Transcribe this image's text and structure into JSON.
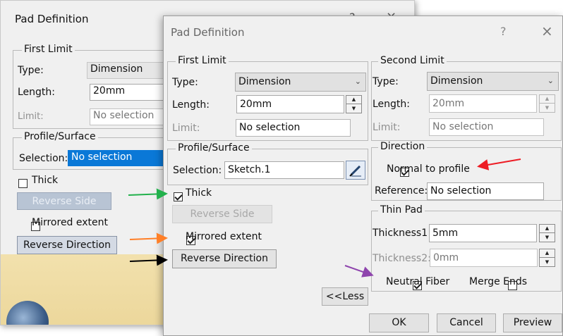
{
  "back_dialog": {
    "title": "Pad Definition",
    "help": "?",
    "close": "×",
    "first_limit": {
      "group_label": "First Limit",
      "type_label": "Type:",
      "type_value": "Dimension",
      "length_label": "Length:",
      "length_value": "20mm",
      "limit_label": "Limit:",
      "limit_value": "No selection"
    },
    "profile_surface": {
      "group_label": "Profile/Surface",
      "selection_label": "Selection:",
      "selection_value": "No selection"
    },
    "thick_label": "Thick",
    "reverse_side_label": "Reverse Side",
    "mirrored_extent_label": "Mirrored extent",
    "reverse_direction_label": "Reverse Direction"
  },
  "front_dialog": {
    "title": "Pad Definition",
    "help": "?",
    "close": "×",
    "first_limit": {
      "group_label": "First Limit",
      "type_label": "Type:",
      "type_value": "Dimension",
      "length_label": "Length:",
      "length_value": "20mm",
      "limit_label": "Limit:",
      "limit_value": "No selection"
    },
    "second_limit": {
      "group_label": "Second Limit",
      "type_label": "Type:",
      "type_value": "Dimension",
      "length_label": "Length:",
      "length_value": "20mm",
      "limit_label": "Limit:",
      "limit_value": "No selection"
    },
    "profile_surface": {
      "group_label": "Profile/Surface",
      "selection_label": "Selection:",
      "selection_value": "Sketch.1"
    },
    "thick": {
      "label": "Thick",
      "checked": true
    },
    "reverse_side_label": "Reverse Side",
    "mirrored_extent": {
      "label": "Mirrored extent",
      "checked": true
    },
    "reverse_direction_label": "Reverse Direction",
    "less_label": "<<Less",
    "direction": {
      "group_label": "Direction",
      "normal_to_profile": {
        "label": "Normal to profile",
        "checked": true
      },
      "reference_label": "Reference:",
      "reference_value": "No selection"
    },
    "thin_pad": {
      "group_label": "Thin Pad",
      "thickness1_label": "Thickness1",
      "thickness1_value": "5mm",
      "thickness2_label": "Thickness2:",
      "thickness2_value": "0mm",
      "neutral_fiber": {
        "label": "Neutral Fiber",
        "checked": true
      },
      "merge_ends": {
        "label": "Merge Ends",
        "checked": false
      }
    },
    "ok_label": "OK",
    "cancel_label": "Cancel",
    "preview_label": "Preview"
  },
  "annotation_arrows": [
    {
      "color": "#22b14c",
      "points_to": "Thick"
    },
    {
      "color": "#ff7f27",
      "points_to": "Mirrored extent"
    },
    {
      "color": "#000000",
      "points_to": "Reverse Direction"
    },
    {
      "color": "#ed1c24",
      "points_to": "Normal to profile"
    },
    {
      "color": "#8e44ad",
      "points_to": "Neutral Fiber"
    }
  ]
}
